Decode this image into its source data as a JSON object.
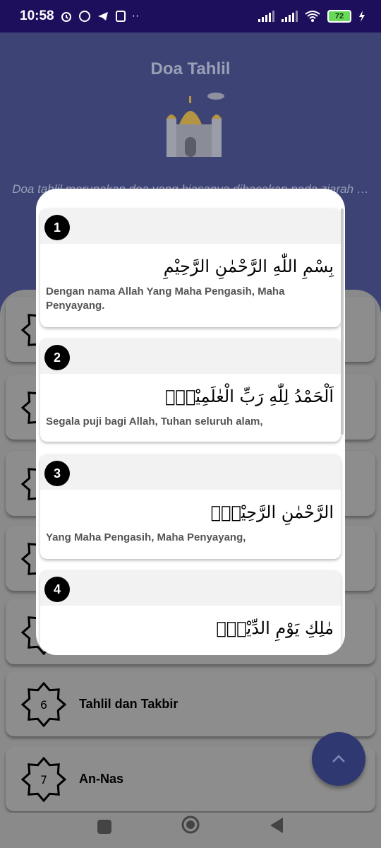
{
  "status_bar": {
    "time": "10:58",
    "battery": "72"
  },
  "background": {
    "title": "Doa Tahlil",
    "description": "Doa tahlil merupakan doa yang biasanya dibacakan pada ziarah … gal. Sa… tuk men… akan",
    "items": [
      {
        "number": "",
        "name": ""
      },
      {
        "number": "",
        "name": ""
      },
      {
        "number": "",
        "name": ""
      },
      {
        "number": "",
        "name": ""
      },
      {
        "number": "",
        "name": ""
      },
      {
        "number": "6",
        "name": "Tahlil dan Takbir"
      },
      {
        "number": "7",
        "name": "An-Nas"
      }
    ]
  },
  "dialog": {
    "verses": [
      {
        "number": "1",
        "arabic": "بِسْمِ اللّٰهِ الرَّحْمٰنِ الرَّحِيْمِ",
        "translation": "Dengan nama Allah Yang Maha Pengasih, Maha Penyayang."
      },
      {
        "number": "2",
        "arabic": "اَلْحَمْدُ لِلّٰهِ رَبِّ الْعٰلَمِيْنَۙ",
        "translation": "Segala puji bagi Allah, Tuhan seluruh alam,"
      },
      {
        "number": "3",
        "arabic": "الرَّحْمٰنِ الرَّحِيْمِۙ",
        "translation": "Yang Maha Pengasih, Maha Penyayang,"
      },
      {
        "number": "4",
        "arabic": "مٰلِكِ يَوْمِ الدِّيْنِۗ",
        "translation": ""
      }
    ]
  },
  "colors": {
    "header_bg": "#3d4475",
    "status_bar": "#1e0f5c",
    "fab": "#2f3870",
    "scrim_panel": "#8a8a8a"
  },
  "icons": {
    "fab": "chevron-up-icon",
    "nav_recent": "square-icon",
    "nav_home": "circle-icon",
    "nav_back": "triangle-back-icon"
  }
}
